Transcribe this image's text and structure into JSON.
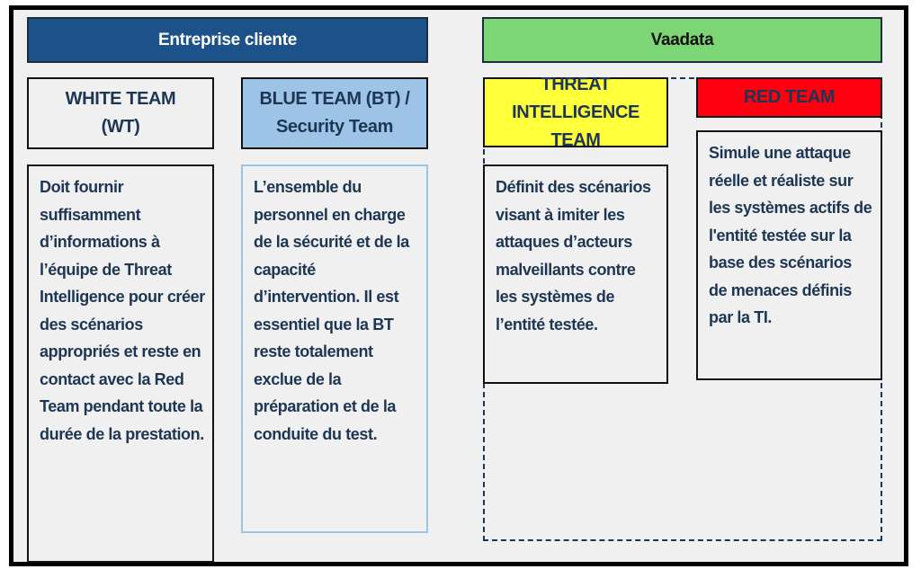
{
  "groups": {
    "client": {
      "label": "Entreprise cliente",
      "color": "#1c5289"
    },
    "vaadata": {
      "label": "Vaadata",
      "color": "#7dd675"
    }
  },
  "teams": {
    "white": {
      "title_line1": "WHITE TEAM",
      "title_line2": "(WT)",
      "color": "#f0f0f0",
      "description": "Doit fournir suffisamment d’informations à l’équipe de Threat Intelligence pour créer des scénarios appropriés et reste en contact avec la Red Team pendant toute la durée de la prestation."
    },
    "blue": {
      "title_line1": "BLUE TEAM (BT) /",
      "title_line2": "Security Team",
      "color": "#9dc3e6",
      "description": "L’ensemble du personnel en charge de la sécurité et de la capacité d’intervention. Il est essentiel que la BT reste totalement exclue de la préparation et de la conduite du test."
    },
    "threat": {
      "title_line1": "THREAT",
      "title_line2": "INTELLIGENCE TEAM",
      "color": "#ffff3c",
      "description": "Définit des scénarios visant à imiter les attaques d’acteurs malveillants contre les systèmes de l’entité testée."
    },
    "red": {
      "title_line1": "RED TEAM",
      "color": "#ff0010",
      "description": "Simule une attaque réelle et réaliste sur les systèmes actifs de l'entité testée sur la base des scénarios de menaces définis par la TI."
    }
  }
}
